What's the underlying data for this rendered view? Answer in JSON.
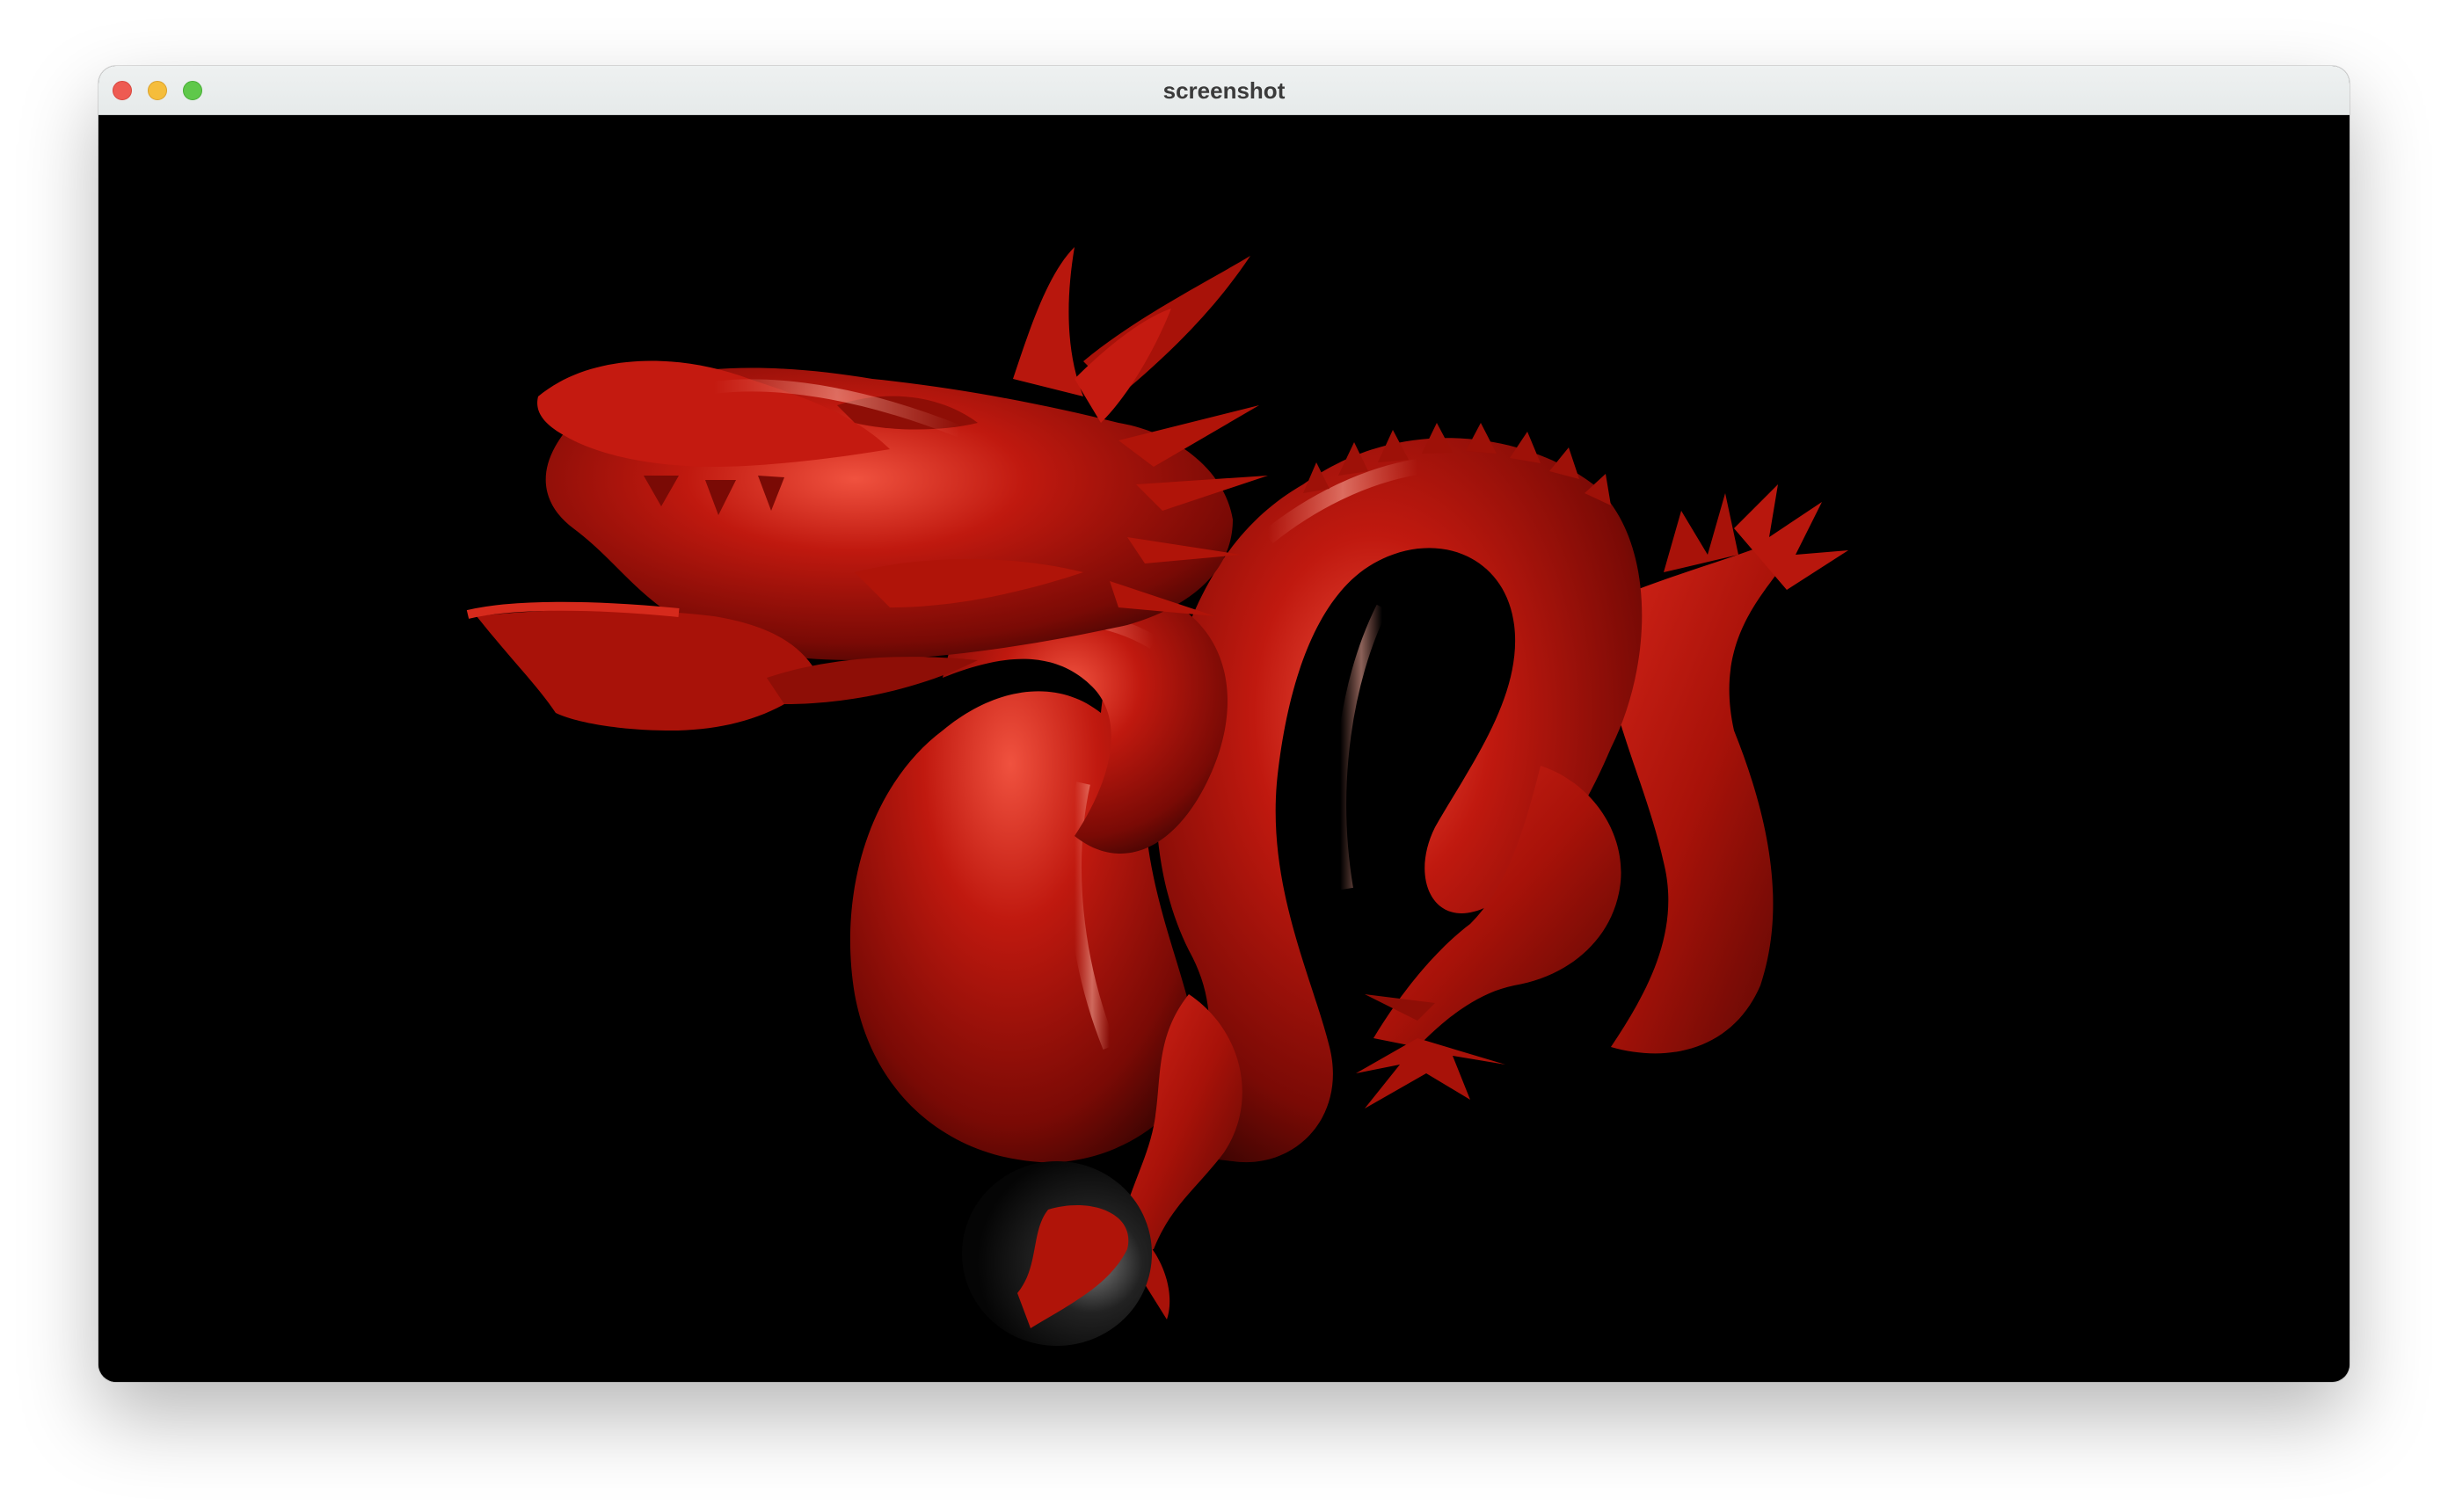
{
  "window": {
    "title": "screenshot"
  },
  "scene": {
    "background_color": "#000000",
    "model_color": "#b3150e",
    "sphere_color": "#1a1a1a",
    "icon": "render-viewport"
  }
}
